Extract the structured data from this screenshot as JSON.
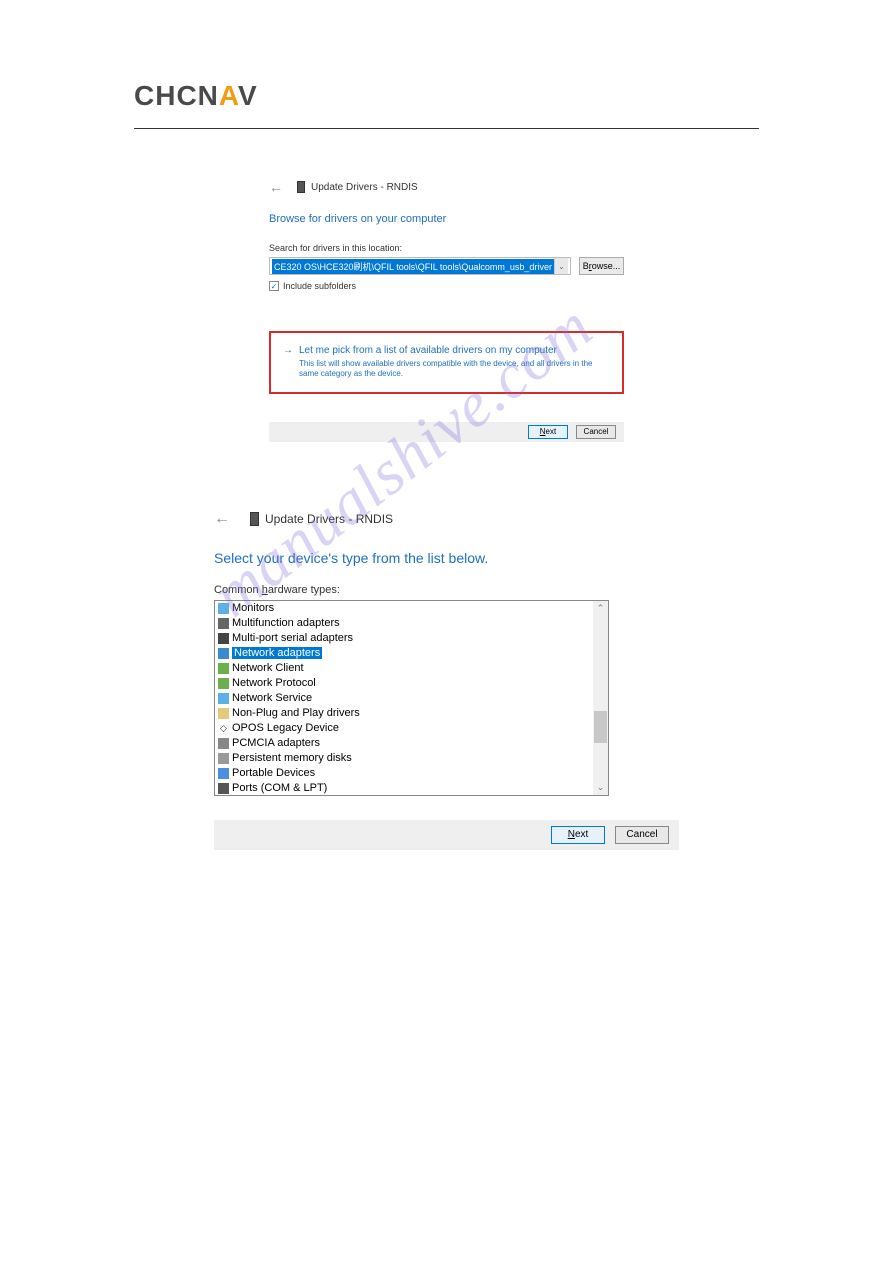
{
  "logo": {
    "part1": "CHCN",
    "part2": "A",
    "part3": "V"
  },
  "watermark": "manualshive.com",
  "dialog1": {
    "title": "Update Drivers - RNDIS",
    "heading": "Browse for drivers on your computer",
    "search_label": "Search for drivers in this location:",
    "path": "CE320 OS\\HCE320刷机\\QFIL tools\\QFIL tools\\Qualcomm_usb_driver",
    "browse": "Browse...",
    "include_subfolders": "Include subfolders",
    "pick_title": "Let me pick from a list of available drivers on my computer",
    "pick_desc": "This list will show available drivers compatible with the device, and all drivers in the same category as the device.",
    "next": "Next",
    "cancel": "Cancel"
  },
  "dialog2": {
    "title": "Update Drivers - RNDIS",
    "heading": "Select your device's type from the list below.",
    "common_label": "Common hardware types:",
    "items": [
      "Monitors",
      "Multifunction adapters",
      "Multi-port serial adapters",
      "Network adapters",
      "Network Client",
      "Network Protocol",
      "Network Service",
      "Non-Plug and Play drivers",
      "OPOS Legacy Device",
      "PCMCIA adapters",
      "Persistent memory disks",
      "Portable Devices",
      "Ports (COM & LPT)"
    ],
    "selected_index": 3,
    "next": "Next",
    "cancel": "Cancel"
  }
}
